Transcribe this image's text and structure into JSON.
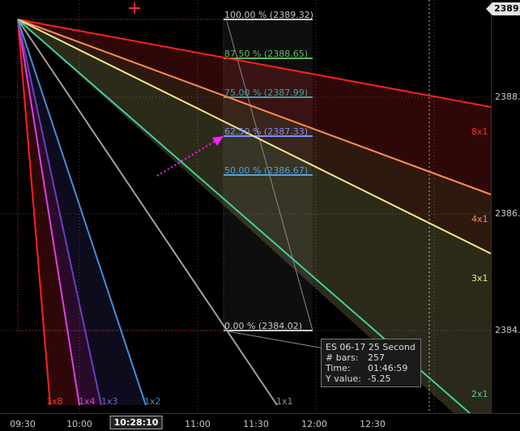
{
  "price_axis": {
    "labels": [
      "2388.",
      "2386.",
      "2384."
    ],
    "last_price": "2389."
  },
  "time_axis": {
    "labels": [
      "09:30",
      "10:00",
      "11:00",
      "11:30",
      "12:00",
      "12:30"
    ],
    "cursor_time": "10:28:10"
  },
  "fib_levels": [
    {
      "label": "100.00 % (2389.32)",
      "color": "#c8c8c8"
    },
    {
      "label": "87.50 % (2388.65)",
      "color": "#5fb85f"
    },
    {
      "label": "75.00 % (2387.99)",
      "color": "#3aa6a6"
    },
    {
      "label": "62.50 % (2387.33)",
      "color": "#8090ff"
    },
    {
      "label": "50.00 % (2386.67)",
      "color": "#55a0d8"
    },
    {
      "label": "0.00 % (2384.02)",
      "color": "#c8c8c8"
    }
  ],
  "gann_fan": {
    "right_labels": [
      {
        "label": "8x1",
        "color": "#ff3030"
      },
      {
        "label": "4x1",
        "color": "#ff8c50"
      },
      {
        "label": "3x1",
        "color": "#f0e68c"
      },
      {
        "label": "2x1",
        "color": "#40d0a0"
      }
    ],
    "bottom_labels": [
      {
        "label": "1x8",
        "color": "#ff3030"
      },
      {
        "label": "1x4",
        "color": "#e040e0"
      },
      {
        "label": "1x3",
        "color": "#8060d0"
      },
      {
        "label": "1x2",
        "color": "#4090d0"
      },
      {
        "label": "1x1",
        "color": "#909090"
      }
    ]
  },
  "tooltip": {
    "title": "ES 06-17 25 Second",
    "rows": [
      {
        "key": "# bars:",
        "value": "257"
      },
      {
        "key": "Time:",
        "value": "01:46:59"
      },
      {
        "key": "Y value:",
        "value": "-5.25"
      }
    ]
  }
}
